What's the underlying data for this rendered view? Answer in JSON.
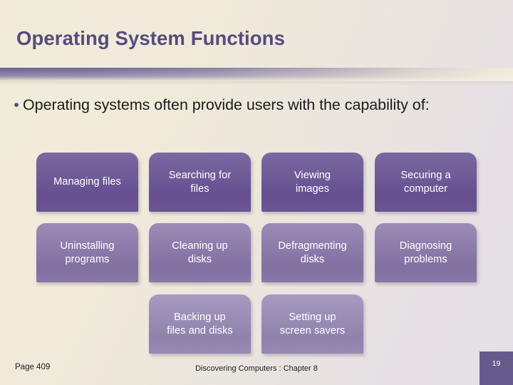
{
  "slide": {
    "title": "Operating System Functions",
    "bullet_marker": "•",
    "bullet_text": "Operating systems often provide users with the capability of:"
  },
  "colors": {
    "title": "#57497E",
    "band_left": "#6A5E92",
    "band_right": "#EFEADA",
    "background_left": "#F1ECDA",
    "background_right": "#E4DFE6",
    "tier_1": "#6B5494",
    "tier_2": "#8878AA",
    "tier_3": "#9B8DB8",
    "slide_number_box": "#655A8C"
  },
  "boxes": {
    "rows": [
      {
        "tier": 1,
        "items": [
          {
            "lines": [
              "Managing files"
            ]
          },
          {
            "lines": [
              "Searching for",
              "files"
            ]
          },
          {
            "lines": [
              "Viewing",
              "images"
            ]
          },
          {
            "lines": [
              "Securing a",
              "computer"
            ]
          }
        ]
      },
      {
        "tier": 2,
        "items": [
          {
            "lines": [
              "Uninstalling",
              "programs"
            ]
          },
          {
            "lines": [
              "Cleaning up",
              "disks"
            ]
          },
          {
            "lines": [
              "Defragmenting",
              "disks"
            ]
          },
          {
            "lines": [
              "Diagnosing",
              "problems"
            ]
          }
        ]
      },
      {
        "tier": 3,
        "items": [
          {
            "lines": [
              "Backing up",
              "files and disks"
            ]
          },
          {
            "lines": [
              "Setting up",
              "screen savers"
            ]
          }
        ]
      }
    ]
  },
  "footer": {
    "page_reference": "Page 409",
    "center_text": "Discovering Computers : Chapter 8",
    "slide_number": "19"
  }
}
